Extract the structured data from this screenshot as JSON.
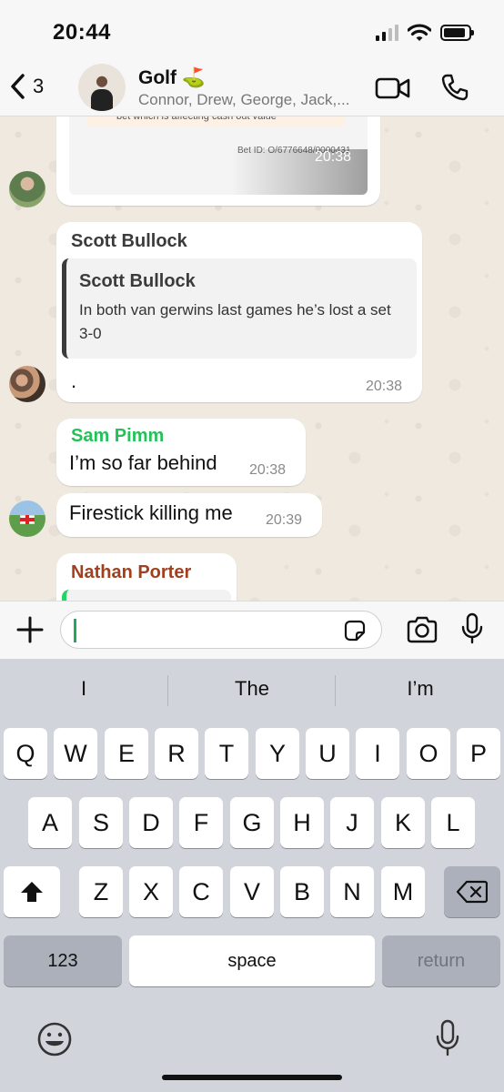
{
  "status_bar": {
    "time": "20:44"
  },
  "header": {
    "back_count": "3",
    "group_name": "Golf ⛳",
    "members": "Connor, Drew, George, Jack,..."
  },
  "messages": {
    "bet_card": {
      "warning": "Bear with us, something is happening within this bet which is affecting cash out value",
      "bet_id": "Bet ID: O/6776648/0000431",
      "time": "20:38"
    },
    "scott": {
      "sender": "Scott Bullock",
      "quote_author": "Scott Bullock",
      "quote_text": "In both van gerwins last games he’s lost a set 3-0",
      "text": ".",
      "time": "20:38"
    },
    "sam": {
      "sender": "Sam Pimm",
      "text": "I’m so far behind",
      "time": "20:38"
    },
    "firestick": {
      "text": "Firestick killing me",
      "time": "20:39"
    },
    "nathan": {
      "sender": "Nathan Porter"
    }
  },
  "colors": {
    "scott_name": "#3b3b3b",
    "sam_name": "#25c05a",
    "nathan_name": "#a0401f",
    "chat_background": "#efe9df"
  },
  "keyboard": {
    "suggestions": [
      "I",
      "The",
      "I’m"
    ],
    "row1": [
      "Q",
      "W",
      "E",
      "R",
      "T",
      "Y",
      "U",
      "I",
      "O",
      "P"
    ],
    "row2": [
      "A",
      "S",
      "D",
      "F",
      "G",
      "H",
      "J",
      "K",
      "L"
    ],
    "row3": [
      "Z",
      "X",
      "C",
      "V",
      "B",
      "N",
      "M"
    ],
    "numbers_label": "123",
    "space_label": "space",
    "return_label": "return"
  },
  "icons": [
    "back-chevron-icon",
    "video-call-icon",
    "phone-icon",
    "plus-icon",
    "sticker-icon",
    "camera-icon",
    "microphone-icon",
    "shift-icon",
    "backspace-icon",
    "emoji-icon",
    "dictation-icon",
    "warning-icon"
  ]
}
